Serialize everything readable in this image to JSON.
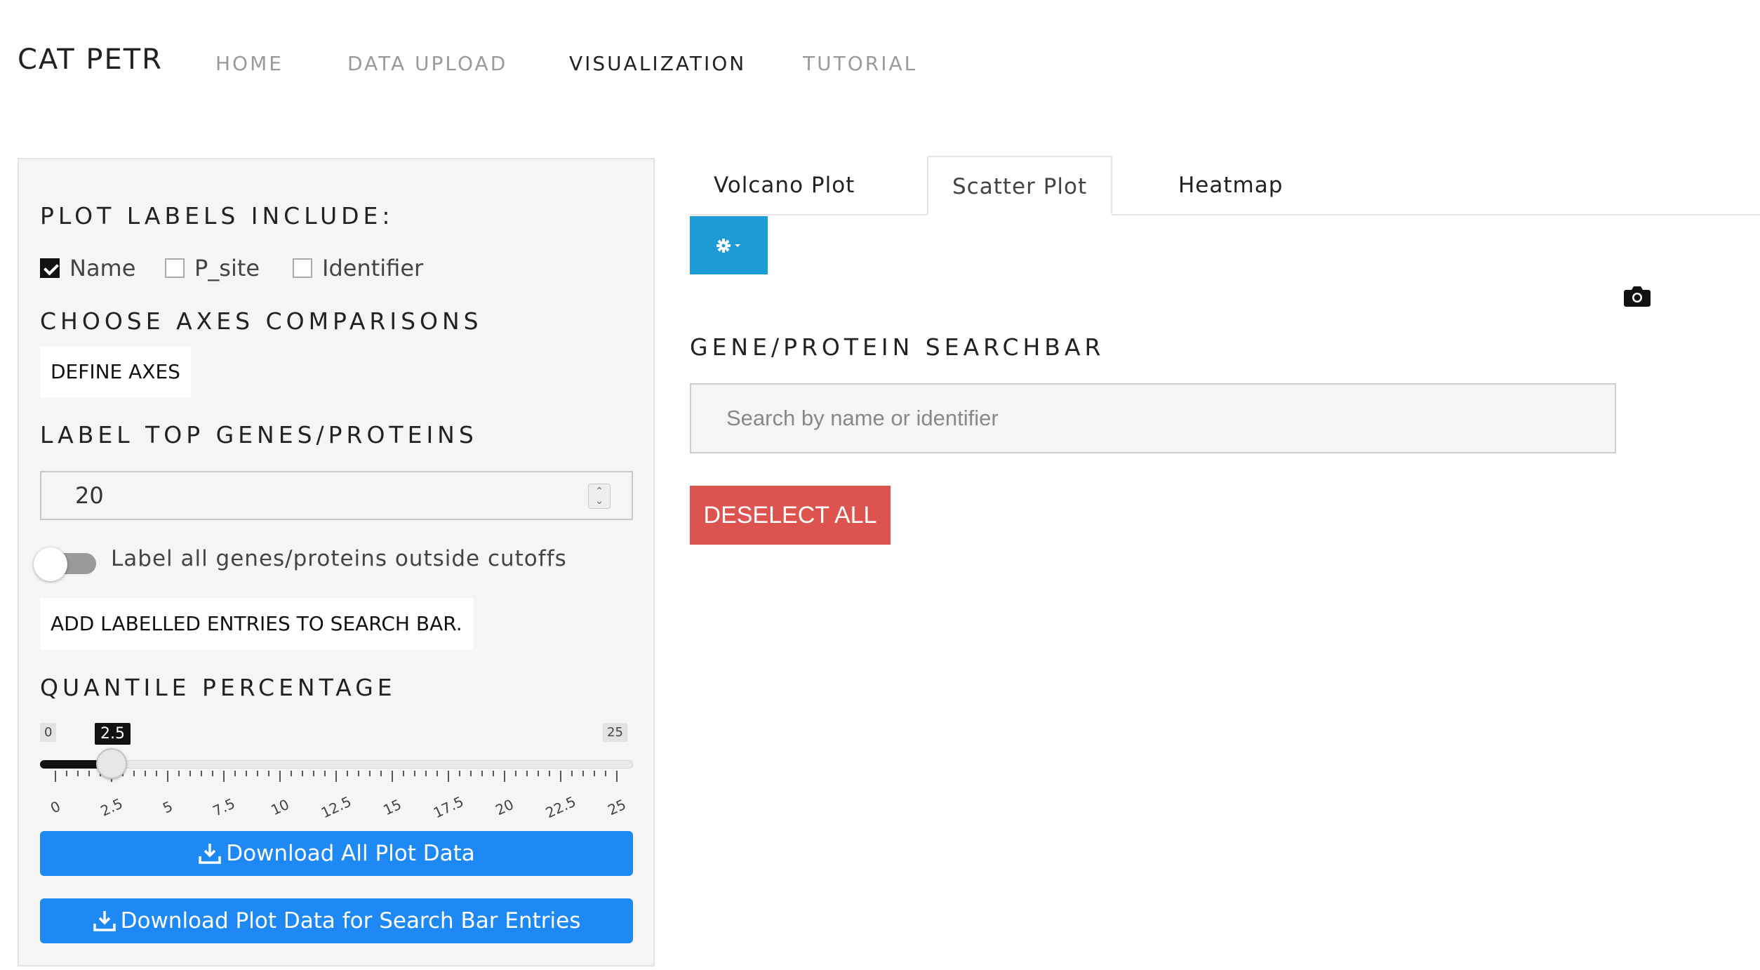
{
  "navbar": {
    "brand": "CAT PETR",
    "items": [
      {
        "label": "HOME",
        "active": false
      },
      {
        "label": "DATA UPLOAD",
        "active": false
      },
      {
        "label": "VISUALIZATION",
        "active": true
      },
      {
        "label": "TUTORIAL",
        "active": false
      }
    ]
  },
  "sidebar": {
    "plot_labels_heading": "PLOT LABELS INCLUDE:",
    "plot_label_options": [
      {
        "label": "Name",
        "checked": true
      },
      {
        "label": "P_site",
        "checked": false
      },
      {
        "label": "Identifier",
        "checked": false
      }
    ],
    "axes_heading": "CHOOSE AXES COMPARISONS",
    "define_axes_button": "DEFINE AXES",
    "label_top_heading": "LABEL TOP GENES/PROTEINS",
    "label_top_value": "20",
    "toggle_label": "Label all genes/proteins outside cutoffs",
    "toggle_on": false,
    "add_labelled_button": "ADD LABELLED ENTRIES TO SEARCH BAR.",
    "quantile_heading": "QUANTILE PERCENTAGE",
    "slider": {
      "min_label": "0",
      "max_label": "25",
      "value_label": "2.5",
      "min": 0,
      "max": 25,
      "value": 2.5,
      "tick_labels": [
        "0",
        "2.5",
        "5",
        "7.5",
        "10",
        "12.5",
        "15",
        "17.5",
        "20",
        "22.5",
        "25"
      ]
    },
    "download_all_button": "Download All Plot Data",
    "download_search_button": "Download Plot Data for Search Bar Entries"
  },
  "main": {
    "tabs": [
      {
        "label": "Volcano Plot",
        "active": false
      },
      {
        "label": "Scatter Plot",
        "active": true
      },
      {
        "label": "Heatmap",
        "active": false
      }
    ],
    "settings_icon": "gear-icon",
    "camera_icon": "camera-icon",
    "search_heading": "GENE/PROTEIN SEARCHBAR",
    "search_placeholder": "Search by name or identifier",
    "deselect_button": "DESELECT ALL"
  },
  "colors": {
    "primary_blue": "#1e88f5",
    "gear_button": "#1d9bd5",
    "deselect_red": "#dc5350",
    "sidebar_bg": "#f5f5f5"
  }
}
